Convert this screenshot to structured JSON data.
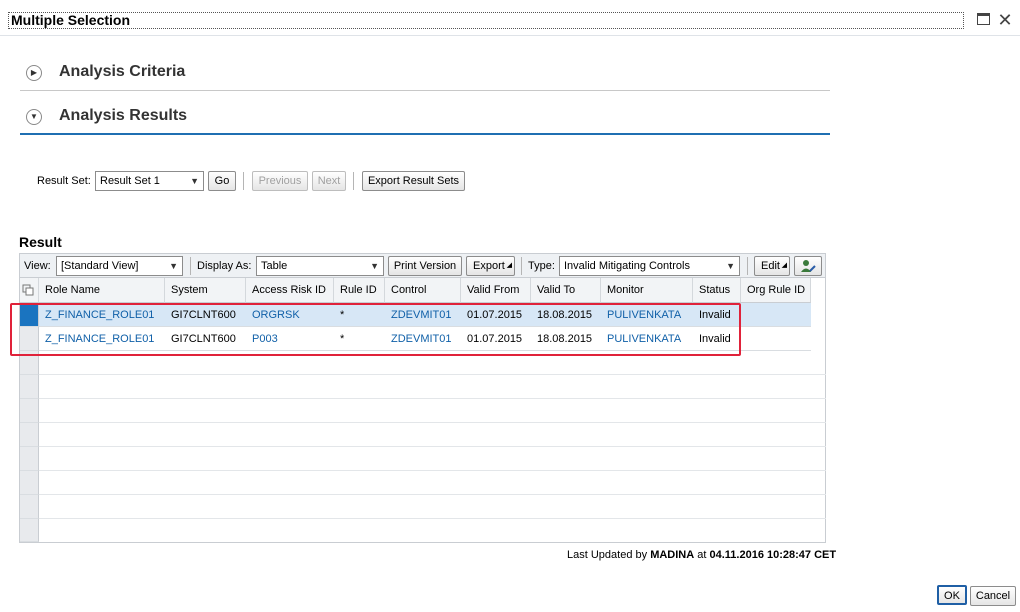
{
  "dialog": {
    "title": "Multiple Selection"
  },
  "sections": {
    "criteria": "Analysis Criteria",
    "results": "Analysis Results"
  },
  "result_set": {
    "label": "Result Set:",
    "value": "Result Set 1",
    "go": "Go",
    "previous": "Previous",
    "next": "Next",
    "export_sets": "Export Result Sets"
  },
  "result": {
    "title": "Result",
    "toolbar": {
      "view_label": "View:",
      "view_value": "[Standard View]",
      "display_label": "Display As:",
      "display_value": "Table",
      "print": "Print Version",
      "export": "Export",
      "type_label": "Type:",
      "type_value": "Invalid Mitigating Controls",
      "edit": "Edit"
    },
    "columns": [
      "Role Name",
      "System",
      "Access Risk ID",
      "Rule ID",
      "Control",
      "Valid From",
      "Valid To",
      "Monitor",
      "Status",
      "Org Rule ID"
    ],
    "rows": [
      [
        "Z_FINANCE_ROLE01",
        "GI7CLNT600",
        "ORGRSK",
        "*",
        "ZDEVMIT01",
        "01.07.2015",
        "18.08.2015",
        "PULIVENKATA",
        "Invalid",
        ""
      ],
      [
        "Z_FINANCE_ROLE01",
        "GI7CLNT600",
        "P003",
        "*",
        "ZDEVMIT01",
        "01.07.2015",
        "18.08.2015",
        "PULIVENKATA",
        "Invalid",
        ""
      ]
    ]
  },
  "footer": {
    "prefix": "Last Updated by",
    "user": "MADINA",
    "at": "at",
    "datetime": "04.11.2016 10:28:47 CET"
  },
  "buttons": {
    "ok": "OK",
    "cancel": "Cancel"
  }
}
